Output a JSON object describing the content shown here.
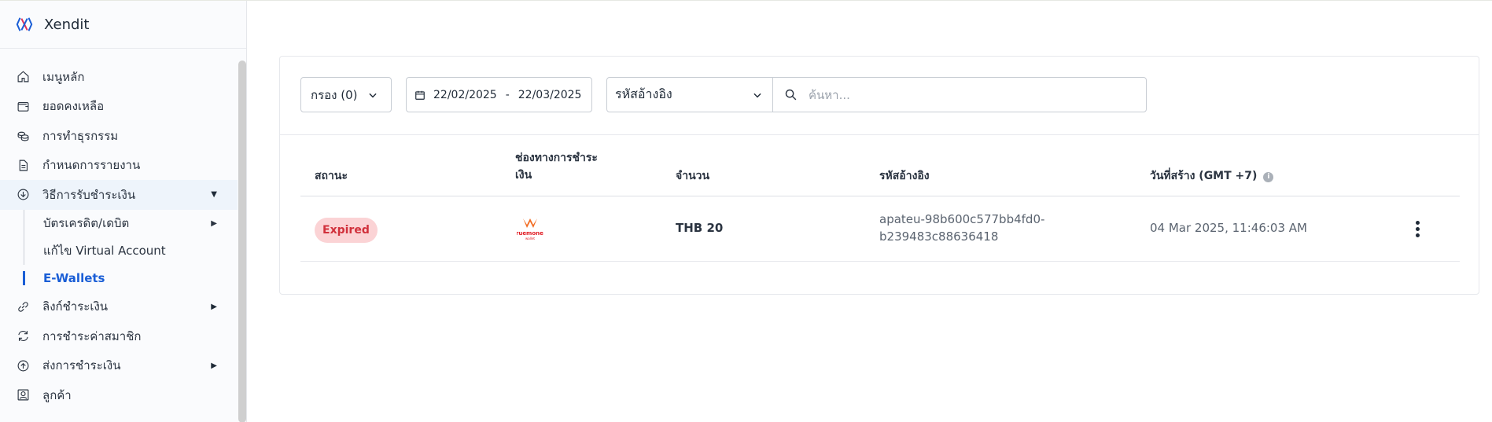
{
  "brand": {
    "name": "Xendit"
  },
  "sidebar": {
    "items": [
      {
        "label": "เมนูหลัก",
        "icon": "home-icon"
      },
      {
        "label": "ยอดคงเหลือ",
        "icon": "wallet-icon"
      },
      {
        "label": "การทำธุรกรรม",
        "icon": "coins-icon"
      },
      {
        "label": "กำหนดการรายงาน",
        "icon": "document-icon"
      },
      {
        "label": "วิธีการรับชำระเงิน",
        "icon": "arrow-down-circle-icon"
      }
    ],
    "sub_items": [
      {
        "label": "บัตรเครดิต/เดบิต"
      },
      {
        "label": "แก้ไข Virtual Account"
      },
      {
        "label": "E-Wallets"
      }
    ],
    "items_after": [
      {
        "label": "ลิงก์ชำระเงิน",
        "icon": "link-icon"
      },
      {
        "label": "การชำระค่าสมาชิก",
        "icon": "refresh-icon"
      },
      {
        "label": "ส่งการชำระเงิน",
        "icon": "arrow-up-circle-icon"
      },
      {
        "label": "ลูกค้า",
        "icon": "user-square-icon"
      }
    ]
  },
  "toolbar": {
    "filter_label": "กรอง (0)",
    "date_from": "22/02/2025",
    "date_separator": "-",
    "date_to": "22/03/2025",
    "ref_select_value": "รหัสอ้างอิง",
    "search_placeholder": "ค้นหา..."
  },
  "table": {
    "headers": {
      "status": "สถานะ",
      "channel_line1": "ช่องทางการชำระ",
      "channel_line2": "เงิน",
      "amount": "จำนวน",
      "reference": "รหัสอ้างอิง",
      "created": "วันที่สร้าง (GMT +7)"
    },
    "rows": [
      {
        "status": "Expired",
        "channel": "truemoney",
        "channel_sub": "wallet",
        "amount": "THB 20",
        "reference_line1": "apateu-98b600c577bb4fd0-",
        "reference_line2": "b239483c88636418",
        "created": "04 Mar 2025, 11:46:03 AM"
      }
    ]
  },
  "colors": {
    "accent": "#1a5ed6",
    "expired_bg": "#fbd3d5",
    "expired_text": "#d1313c",
    "truemoney_orange": "#f26b21",
    "truemoney_red": "#e11b22"
  }
}
